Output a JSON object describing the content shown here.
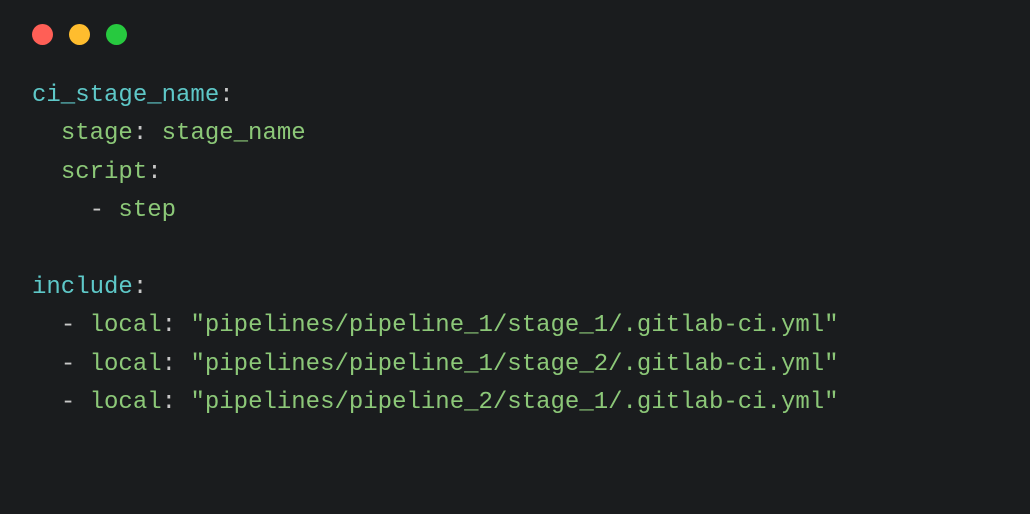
{
  "window": {
    "traffic_lights": [
      "close",
      "minimize",
      "maximize"
    ]
  },
  "code": {
    "job_name": "ci_stage_name",
    "stage_key": "stage",
    "stage_value": "stage_name",
    "script_key": "script",
    "step": "step",
    "include_key": "include",
    "includes": [
      {
        "key": "local",
        "value": "\"pipelines/pipeline_1/stage_1/.gitlab-ci.yml\""
      },
      {
        "key": "local",
        "value": "\"pipelines/pipeline_1/stage_2/.gitlab-ci.yml\""
      },
      {
        "key": "local",
        "value": "\"pipelines/pipeline_2/stage_1/.gitlab-ci.yml\""
      }
    ],
    "colon": ":",
    "dash": "-",
    "space": " "
  }
}
